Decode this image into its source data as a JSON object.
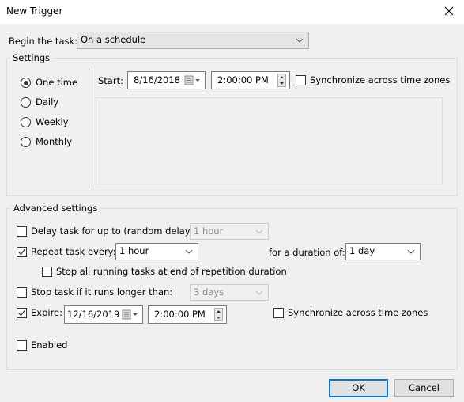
{
  "window": {
    "title": "New Trigger",
    "close_icon": "close-icon"
  },
  "begin": {
    "label": "Begin the task:",
    "value": "On a schedule"
  },
  "settings": {
    "group_label": "Settings",
    "schedule_options": [
      {
        "label": "One time",
        "selected": true
      },
      {
        "label": "Daily",
        "selected": false
      },
      {
        "label": "Weekly",
        "selected": false
      },
      {
        "label": "Monthly",
        "selected": false
      }
    ],
    "start_label": "Start:",
    "start_date": "8/16/2018",
    "start_time": "2:00:00 PM",
    "sync_label": "Synchronize across time zones",
    "sync_checked": false
  },
  "advanced": {
    "group_label": "Advanced settings",
    "delay": {
      "label": "Delay task for up to (random delay):",
      "checked": false,
      "value": "1 hour",
      "enabled": false
    },
    "repeat": {
      "label": "Repeat task every:",
      "checked": true,
      "value": "1 hour",
      "duration_label": "for a duration of:",
      "duration_value": "1 day"
    },
    "stop_all": {
      "label": "Stop all running tasks at end of repetition duration",
      "checked": false
    },
    "stop_longer": {
      "label": "Stop task if it runs longer than:",
      "checked": false,
      "value": "3 days",
      "enabled": false
    },
    "expire": {
      "label": "Expire:",
      "checked": true,
      "date": "12/16/2019",
      "time": "2:00:00 PM",
      "sync_label": "Synchronize across time zones",
      "sync_checked": false
    },
    "enabled": {
      "label": "Enabled",
      "checked": false
    }
  },
  "buttons": {
    "ok": "OK",
    "cancel": "Cancel"
  }
}
